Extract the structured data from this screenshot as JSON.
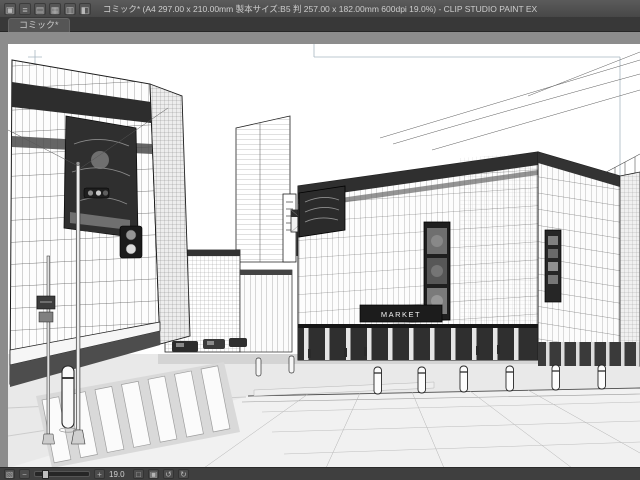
{
  "window": {
    "title": "コミック* (A4 297.00 x 210.00mm 製本サイズ:B5 判 257.00 x 182.00mm 600dpi 19.0%) - CLIP STUDIO PAINT EX"
  },
  "titlebar": {
    "icons": [
      {
        "name": "app",
        "glyph": "▣"
      },
      {
        "name": "menu",
        "glyph": "≡"
      },
      {
        "name": "panel",
        "glyph": "▤"
      },
      {
        "name": "grid",
        "glyph": "▦"
      },
      {
        "name": "layers",
        "glyph": "▥"
      },
      {
        "name": "settings",
        "glyph": "◧"
      }
    ]
  },
  "tabbar": {
    "active_tab": "コミック*"
  },
  "canvas": {
    "sign_text": "MARKET"
  },
  "statusbar": {
    "nav_glyph": "▧",
    "zoom_out_glyph": "−",
    "zoom_in_glyph": "+",
    "zoom_value": "19.0",
    "fit_glyph": "□",
    "actual_glyph": "▣",
    "rotate_left_glyph": "↺",
    "rotate_right_glyph": "↻"
  },
  "colors": {
    "guide": "#a8b6c2",
    "ui_dark": "#3f3f3f",
    "canvas_surround": "#8c8c8c"
  }
}
